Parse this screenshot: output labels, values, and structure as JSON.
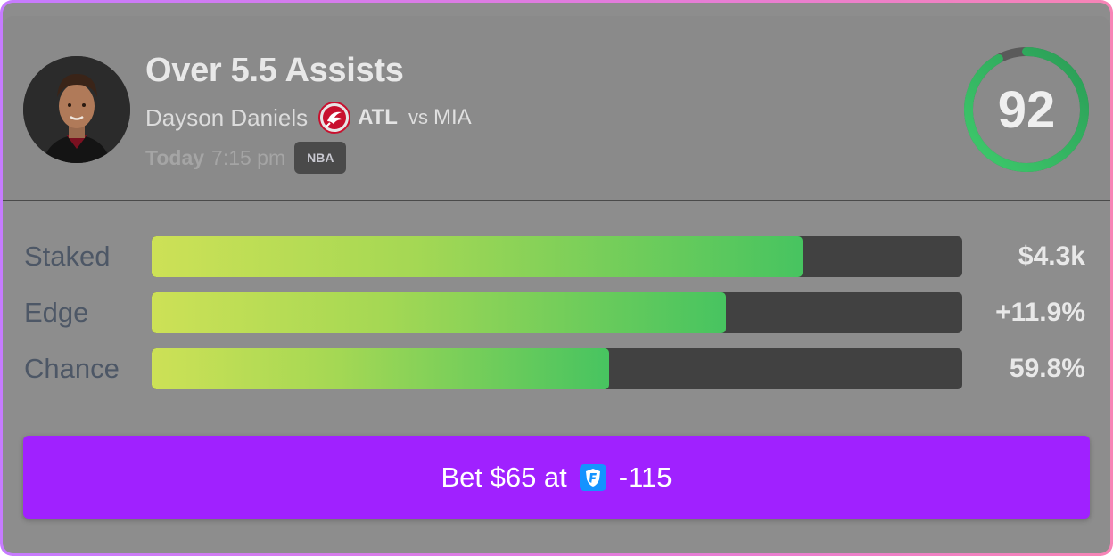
{
  "pick": {
    "title": "Over 5.5 Assists",
    "player": "Dayson Daniels",
    "team": "ATL",
    "vs": "vs",
    "opponent": "MIA",
    "day": "Today",
    "time": "7:15 pm",
    "league": "NBA",
    "score": "92",
    "score_fraction": 0.92
  },
  "metrics": [
    {
      "label": "Staked",
      "value": "$4.3k",
      "fill": 0.803
    },
    {
      "label": "Edge",
      "value": "+11.9%",
      "fill": 0.709
    },
    {
      "label": "Chance",
      "value": "59.8%",
      "fill": 0.564
    }
  ],
  "bet": {
    "prefix": "Bet $65 at",
    "odds": "-115",
    "book_icon": "fanduel-shield-icon"
  },
  "colors": {
    "accent_purple": "#a021ff",
    "bar_start": "#cde156",
    "bar_end": "#47c460",
    "ring_green": "#33c466",
    "team_red": "#c8102e"
  },
  "icons": {
    "avatar": "player-headshot",
    "team_logo": "hawks-logo-icon"
  }
}
